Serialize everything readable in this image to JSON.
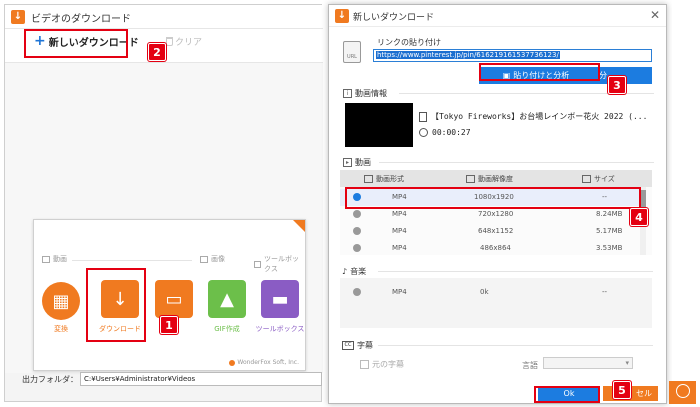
{
  "background_window": {
    "title": "ビデオのダウンロード",
    "toolbar": {
      "new_download_label": "新しいダウンロード",
      "clear_label": "クリア"
    },
    "launcher": {
      "groups": [
        {
          "label": "動画"
        },
        {
          "label": "画像"
        },
        {
          "label": "ツールボックス"
        }
      ],
      "tiles": [
        {
          "label": "変換",
          "icon": "film-icon",
          "color": "#f07a20"
        },
        {
          "label": "ダウンロード",
          "icon": "download-arrow-icon",
          "color": "#f07a20"
        },
        {
          "label": "",
          "icon": "screen-record-icon",
          "color": "#f07a20"
        },
        {
          "label": "GIF作成",
          "icon": "image-icon",
          "color": "#6cbf4a"
        },
        {
          "label": "ツールボックス",
          "icon": "toolbox-icon",
          "color": "#8a5cc4"
        }
      ],
      "footer": "WonderFox Soft, Inc."
    },
    "output_folder": {
      "label": "出力フォルダ：",
      "value": "C:¥Users¥Administrator¥Videos"
    }
  },
  "dialog": {
    "title": "新しいダウンロード",
    "paste_section": {
      "label": "リンクの貼り付け",
      "url_value": "https://www.pinterest.jp/pin/616219161537736123/",
      "paste_analyze_button": "貼り付けと分析",
      "analyze_button": "分"
    },
    "video_info": {
      "section_label": "動画情報",
      "title": "【Tokyo Fireworks】お台場レインボー花火 2022 (...",
      "duration": "00:00:27"
    },
    "video_section": {
      "label": "動画",
      "columns": [
        "動画形式",
        "動画解像度",
        "サイズ"
      ],
      "rows": [
        {
          "format": "MP4",
          "resolution": "1080x1920",
          "size": "--",
          "selected": true
        },
        {
          "format": "MP4",
          "resolution": "720x1280",
          "size": "8.24MB",
          "selected": false
        },
        {
          "format": "MP4",
          "resolution": "648x1152",
          "size": "5.17MB",
          "selected": false
        },
        {
          "format": "MP4",
          "resolution": "486x864",
          "size": "3.53MB",
          "selected": false
        }
      ]
    },
    "audio_section": {
      "label": "音楽",
      "rows": [
        {
          "format": "MP4",
          "bitrate": "0k",
          "size": "--"
        }
      ]
    },
    "subtitle_section": {
      "label": "字幕",
      "original_subtitle_label": "元の字幕",
      "language_label": "言語"
    },
    "buttons": {
      "ok": "Ok",
      "cancel": "セル"
    }
  },
  "annotations": [
    "1",
    "2",
    "3",
    "4",
    "5"
  ],
  "colors": {
    "accent_blue": "#1c7ce0",
    "accent_orange": "#f07a20",
    "highlight_red": "#e40012"
  }
}
